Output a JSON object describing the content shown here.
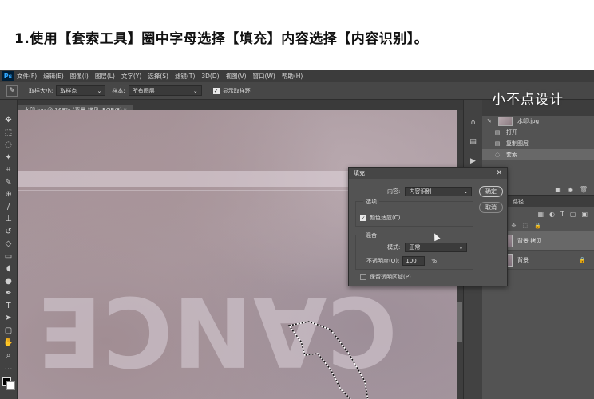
{
  "instruction": "1.使用【套索工具】圈中字母选择【填充】内容选择【内容识别】。",
  "brand": "小不点设计",
  "app": {
    "logo": "Ps",
    "menu": [
      "文件(F)",
      "编辑(E)",
      "图像(I)",
      "图层(L)",
      "文字(Y)",
      "选择(S)",
      "滤镜(T)",
      "3D(D)",
      "视图(V)",
      "窗口(W)",
      "帮助(H)"
    ]
  },
  "options_bar": {
    "tool_icon": "eyedropper-icon",
    "sample_size_label": "取样大小:",
    "sample_size_value": "取样点",
    "sample_label": "样本:",
    "sample_value": "所有图层",
    "show_ring_label": "显示取样环",
    "show_ring_checked": true
  },
  "document": {
    "tab_label": "水印.jpg @ 368% (背景 拷贝, RGB/8) *",
    "watermark_text": "CANCE"
  },
  "history": {
    "items": [
      {
        "label": "水印.jpg",
        "type": "snapshot"
      },
      {
        "label": "打开",
        "type": "step"
      },
      {
        "label": "复制图层",
        "type": "step"
      },
      {
        "label": "套索",
        "type": "step",
        "selected": true
      }
    ]
  },
  "layers": {
    "tabs": [
      "图层",
      "路径"
    ],
    "items": [
      {
        "name": "背景 拷贝",
        "selected": true,
        "locked": false
      },
      {
        "name": "背景",
        "selected": false,
        "locked": true
      }
    ]
  },
  "fill_dialog": {
    "title": "填充",
    "content_label": "内容:",
    "content_value": "内容识别",
    "options_title": "选项",
    "color_adapt_label": "颜色适应(C)",
    "color_adapt_checked": true,
    "blend_title": "混合",
    "mode_label": "模式:",
    "mode_value": "正常",
    "opacity_label": "不透明度(O):",
    "opacity_value": "100",
    "opacity_unit": "%",
    "preserve_label": "保留透明区域(P)",
    "preserve_checked": false,
    "ok_label": "确定",
    "cancel_label": "取消"
  }
}
